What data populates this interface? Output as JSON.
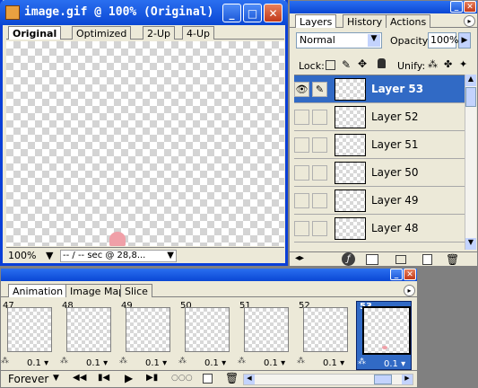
{
  "doc": {
    "title": "image.gif @ 100% (Original)",
    "tabs": [
      "Original",
      "Optimized",
      "2-Up",
      "4-Up"
    ],
    "zoom": "100%",
    "status": "-- / -- sec @ 28,8..."
  },
  "layers_panel": {
    "tabs": [
      "Layers",
      "History",
      "Actions"
    ],
    "blend_mode": "Normal",
    "opacity_label": "Opacity:",
    "opacity_value": "100%",
    "lock_label": "Lock:",
    "unify_label": "Unify:",
    "layers": [
      {
        "name": "Layer 53",
        "selected": true
      },
      {
        "name": "Layer 52",
        "selected": false
      },
      {
        "name": "Layer 51",
        "selected": false
      },
      {
        "name": "Layer 50",
        "selected": false
      },
      {
        "name": "Layer 49",
        "selected": false
      },
      {
        "name": "Layer 48",
        "selected": false
      }
    ]
  },
  "anim_panel": {
    "tabs": [
      "Animation",
      "Image Map",
      "Slice"
    ],
    "loop": "Forever",
    "frames": [
      {
        "num": "47",
        "delay": "0.1"
      },
      {
        "num": "48",
        "delay": "0.1"
      },
      {
        "num": "49",
        "delay": "0.1"
      },
      {
        "num": "50",
        "delay": "0.1"
      },
      {
        "num": "51",
        "delay": "0.1"
      },
      {
        "num": "52",
        "delay": "0.1"
      },
      {
        "num": "53",
        "delay": "0.1"
      }
    ]
  }
}
